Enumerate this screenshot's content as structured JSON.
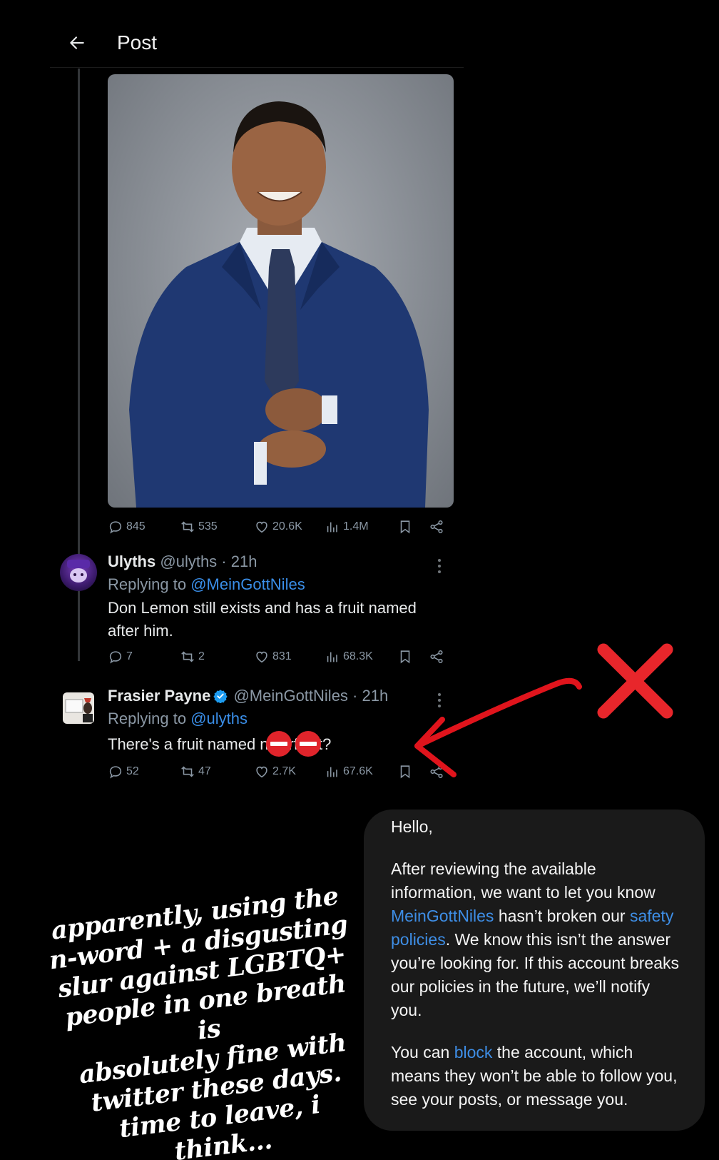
{
  "header": {
    "title": "Post"
  },
  "original_post": {
    "stats": {
      "replies": "845",
      "reposts": "535",
      "likes": "20.6K",
      "views": "1.4M"
    }
  },
  "reply1": {
    "name": "Ulyths",
    "meta": "@ulyths · 21h",
    "replying_prefix": "Replying to",
    "replying_handle": "@MeinGottNiles",
    "text_line1": "Don Lemon still exists and has a fruit named",
    "text_line2": "after him.",
    "stats": {
      "replies": "7",
      "reposts": "2",
      "likes": "831",
      "views": "68.3K"
    }
  },
  "reply2": {
    "name": "Frasier Payne",
    "meta": "@MeinGottNiles · 21h",
    "replying_prefix": "Replying to",
    "replying_handle": "@ulyths",
    "text_part1": "There's a fruit named n",
    "text_part2": "rf",
    "text_part3": "t?",
    "stats": {
      "replies": "52",
      "reposts": "47",
      "likes": "2.7K",
      "views": "67.6K"
    }
  },
  "caption": {
    "lines": [
      "apparently, using the",
      "n-word + a disgusting",
      "slur against LGBTQ+",
      "people in one breath is",
      "absolutely fine with",
      "twitter these days.",
      "time to leave, i think..."
    ]
  },
  "message_card": {
    "greeting": "Hello,",
    "p1_a": "After reviewing the available information, we want to let you know ",
    "p1_link1": "MeinGottNiles",
    "p1_b": " hasn’t broken our ",
    "p1_link2": "safety policies",
    "p1_c": ". We know this isn’t the answer you’re looking for. If this account breaks our policies in the future, we’ll notify you.",
    "p2_a": "You can ",
    "p2_link": "block",
    "p2_b": " the account, which means they won’t be able to follow you, see your posts, or message you."
  },
  "colors": {
    "background": "#000000",
    "link": "#3a8ee8",
    "muted": "#8b98a5",
    "annotation_red": "#e8262b",
    "card_bg": "#1a1a1a"
  },
  "icons": [
    "back-arrow-icon",
    "reply-icon",
    "repost-icon",
    "like-icon",
    "views-icon",
    "bookmark-icon",
    "share-icon",
    "verified-icon",
    "no-entry-emoji",
    "red-x-mark",
    "red-arrow"
  ]
}
